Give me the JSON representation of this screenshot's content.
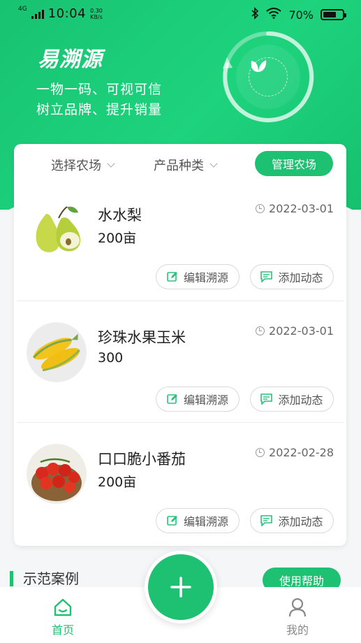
{
  "status_bar": {
    "network": "4G",
    "time": "10:04",
    "speed_value": "0.30",
    "speed_unit": "KB/s",
    "battery_text": "70%",
    "battery_level": 0.7
  },
  "header": {
    "logo": "易溯源",
    "slogan_line1": "一物一码、可视可信",
    "slogan_line2": "树立品牌、提升销量"
  },
  "filters": {
    "farm_label": "选择农场",
    "category_label": "产品种类",
    "manage_button": "管理农场"
  },
  "products": [
    {
      "name": "水水梨",
      "quantity": "200亩",
      "date": "2022-03-01",
      "image_icon": "pear-icon",
      "edit_label": "编辑溯源",
      "add_label": "添加动态"
    },
    {
      "name": "珍珠水果玉米",
      "quantity": "300",
      "date": "2022-03-01",
      "image_icon": "corn-icon",
      "edit_label": "编辑溯源",
      "add_label": "添加动态"
    },
    {
      "name": "口口脆小番茄",
      "quantity": "200亩",
      "date": "2022-02-28",
      "image_icon": "tomato-icon",
      "edit_label": "编辑溯源",
      "add_label": "添加动态"
    }
  ],
  "section": {
    "demo_title": "示范案例",
    "help_button": "使用帮助"
  },
  "tabbar": {
    "home_label": "首页",
    "mine_label": "我的"
  },
  "colors": {
    "accent": "#1ec172",
    "hero": "#17c271"
  }
}
